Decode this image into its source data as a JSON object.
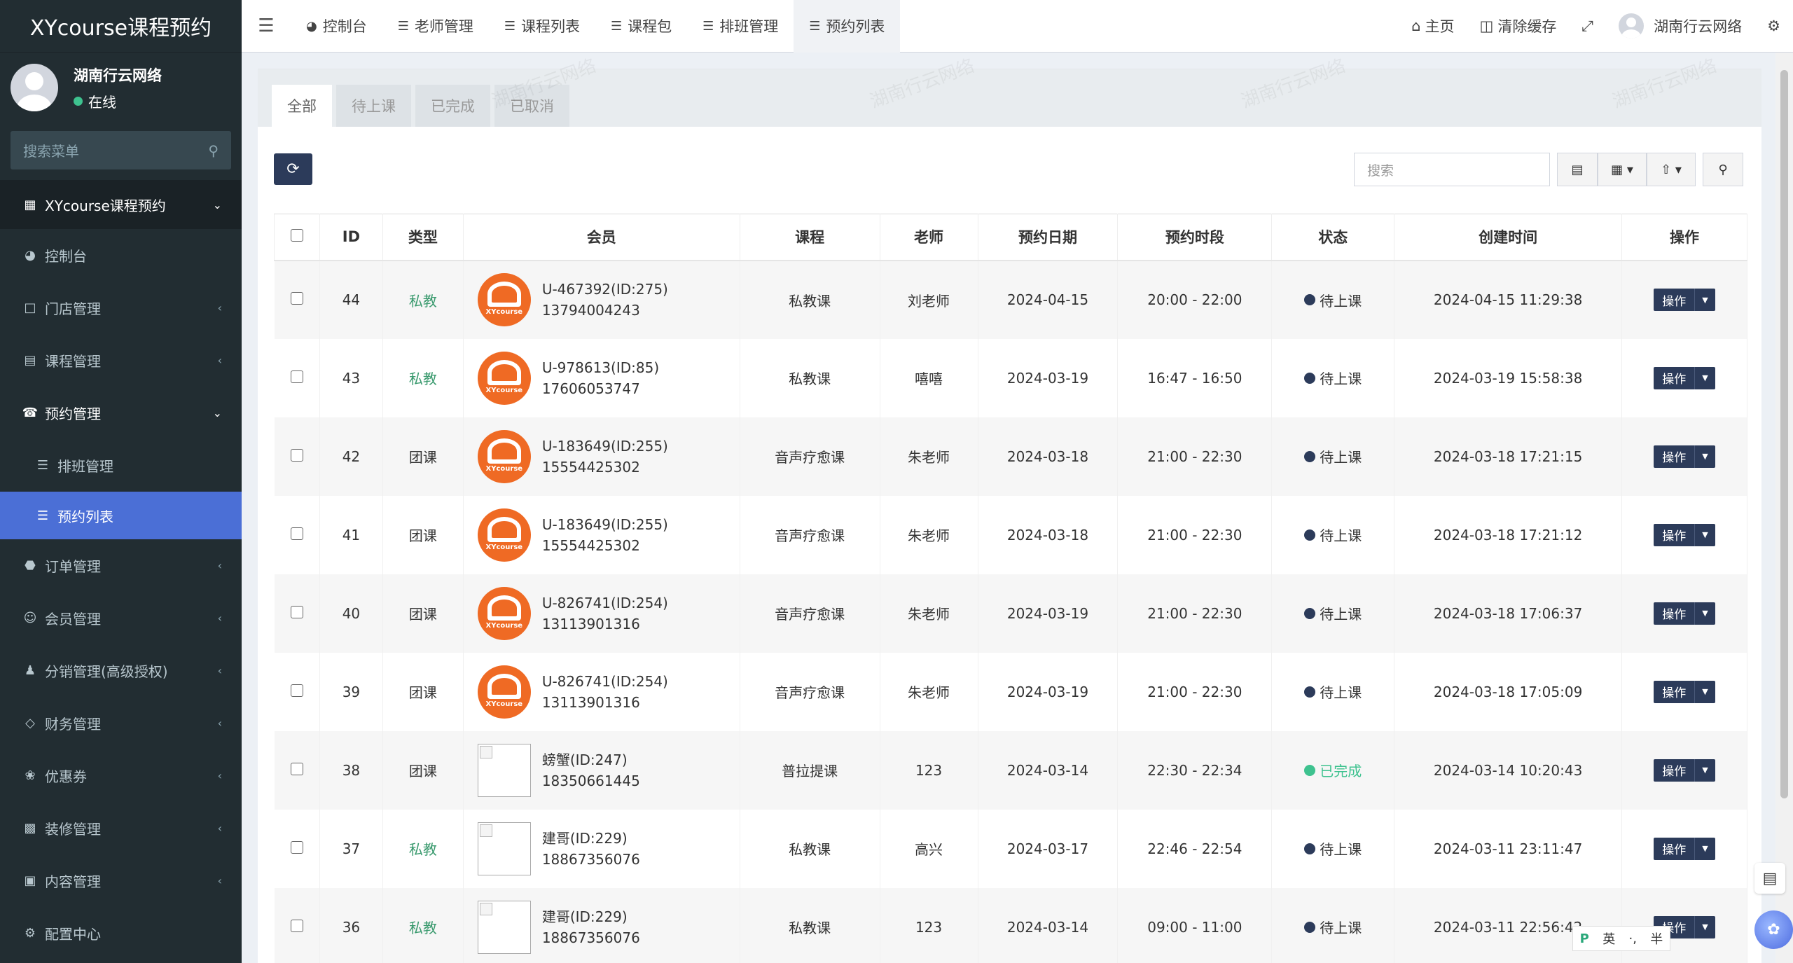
{
  "brand": "XYcourse课程预约",
  "user": {
    "name": "湖南行云网络",
    "status": "在线"
  },
  "sidebar": {
    "search_placeholder": "搜索菜单",
    "header": "XYcourse课程预约",
    "items": [
      {
        "label": "控制台",
        "icon": "dashboard-icon"
      },
      {
        "label": "门店管理",
        "icon": "store-icon"
      },
      {
        "label": "课程管理",
        "icon": "book-icon"
      },
      {
        "label": "预约管理",
        "icon": "whatsapp-icon"
      },
      {
        "label": "排班管理",
        "icon": "list-icon"
      },
      {
        "label": "预约列表",
        "icon": "list-icon"
      },
      {
        "label": "订单管理",
        "icon": "order-icon"
      },
      {
        "label": "会员管理",
        "icon": "user-circle-icon"
      },
      {
        "label": "分销管理(高级授权)",
        "icon": "users-icon"
      },
      {
        "label": "财务管理",
        "icon": "diamond-icon"
      },
      {
        "label": "优惠券",
        "icon": "coupon-icon"
      },
      {
        "label": "装修管理",
        "icon": "paint-icon"
      },
      {
        "label": "内容管理",
        "icon": "content-icon"
      },
      {
        "label": "配置中心",
        "icon": "gear-icon"
      }
    ]
  },
  "topnav": {
    "tabs": [
      "控制台",
      "老师管理",
      "课程列表",
      "课程包",
      "排班管理",
      "预约列表"
    ],
    "home": "主页",
    "clear_cache": "清除缓存",
    "user": "湖南行云网络"
  },
  "filter_tabs": [
    "全部",
    "待上课",
    "已完成",
    "已取消"
  ],
  "search_placeholder": "搜索",
  "table": {
    "headers": [
      "ID",
      "类型",
      "会员",
      "课程",
      "老师",
      "预约日期",
      "预约时段",
      "状态",
      "创建时间",
      "操作"
    ],
    "op_label": "操作",
    "logo_text": "XYcourse",
    "rows": [
      {
        "id": "44",
        "type": "私教",
        "member": "U-467392(ID:275)",
        "phone": "13794004243",
        "course": "私教课",
        "teacher": "刘老师",
        "date": "2024-04-15",
        "slot": "20:00 - 22:00",
        "status": "待上课",
        "created": "2024-04-15 11:29:38"
      },
      {
        "id": "43",
        "type": "私教",
        "member": "U-978613(ID:85)",
        "phone": "17606053747",
        "course": "私教课",
        "teacher": "嘻嘻",
        "date": "2024-03-19",
        "slot": "16:47 - 16:50",
        "status": "待上课",
        "created": "2024-03-19 15:58:38"
      },
      {
        "id": "42",
        "type": "团课",
        "member": "U-183649(ID:255)",
        "phone": "15554425302",
        "course": "音声疗愈课",
        "teacher": "朱老师",
        "date": "2024-03-18",
        "slot": "21:00 - 22:30",
        "status": "待上课",
        "created": "2024-03-18 17:21:15"
      },
      {
        "id": "41",
        "type": "团课",
        "member": "U-183649(ID:255)",
        "phone": "15554425302",
        "course": "音声疗愈课",
        "teacher": "朱老师",
        "date": "2024-03-18",
        "slot": "21:00 - 22:30",
        "status": "待上课",
        "created": "2024-03-18 17:21:12"
      },
      {
        "id": "40",
        "type": "团课",
        "member": "U-826741(ID:254)",
        "phone": "13113901316",
        "course": "音声疗愈课",
        "teacher": "朱老师",
        "date": "2024-03-19",
        "slot": "21:00 - 22:30",
        "status": "待上课",
        "created": "2024-03-18 17:06:37"
      },
      {
        "id": "39",
        "type": "团课",
        "member": "U-826741(ID:254)",
        "phone": "13113901316",
        "course": "音声疗愈课",
        "teacher": "朱老师",
        "date": "2024-03-19",
        "slot": "21:00 - 22:30",
        "status": "待上课",
        "created": "2024-03-18 17:05:09"
      },
      {
        "id": "38",
        "type": "团课",
        "member": "螃蟹(ID:247)",
        "phone": "18350661445",
        "course": "普拉提课",
        "teacher": "123",
        "date": "2024-03-14",
        "slot": "22:30 - 22:34",
        "status": "已完成",
        "created": "2024-03-14 10:20:43"
      },
      {
        "id": "37",
        "type": "私教",
        "member": "建哥(ID:229)",
        "phone": "18867356076",
        "course": "私教课",
        "teacher": "高兴",
        "date": "2024-03-17",
        "slot": "22:46 - 22:54",
        "status": "待上课",
        "created": "2024-03-11 23:11:47"
      },
      {
        "id": "36",
        "type": "私教",
        "member": "建哥(ID:229)",
        "phone": "18867356076",
        "course": "私教课",
        "teacher": "123",
        "date": "2024-03-14",
        "slot": "09:00 - 11:00",
        "status": "待上课",
        "created": "2024-03-11 22:56:42"
      }
    ]
  },
  "ime": {
    "lang": "英",
    "punct": "·,",
    "width": "半"
  },
  "watermark": "湖南行云网络",
  "colors": {
    "pending": "#2c3b5a",
    "done": "#3ec28f",
    "private": "#3a9a6e",
    "active": "#4b6fd6"
  }
}
